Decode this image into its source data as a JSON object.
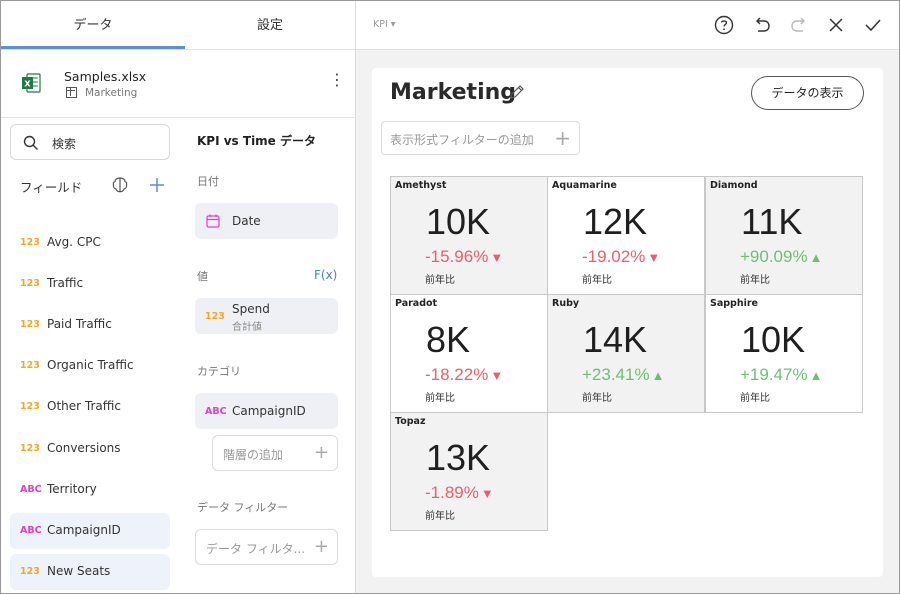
{
  "tabs": {
    "data": "データ",
    "settings": "設定"
  },
  "file": {
    "name": "Samples.xlsx",
    "sheet": "Marketing"
  },
  "search": {
    "label": "検索"
  },
  "fields": {
    "header": "フィールド",
    "items": [
      {
        "type": "123",
        "name": "Avg. CPC"
      },
      {
        "type": "123",
        "name": "Traffic"
      },
      {
        "type": "123",
        "name": "Paid Traffic"
      },
      {
        "type": "123",
        "name": "Organic Traffic"
      },
      {
        "type": "123",
        "name": "Other Traffic"
      },
      {
        "type": "123",
        "name": "Conversions"
      },
      {
        "type": "ABC",
        "name": "Territory"
      },
      {
        "type": "ABC",
        "name": "CampaignID"
      },
      {
        "type": "123",
        "name": "New Seats"
      }
    ]
  },
  "config": {
    "header": "KPI vs Time データ",
    "date_section": "日付",
    "date_field": "Date",
    "value_section": "値",
    "fx": "F(x)",
    "value_field": {
      "type": "123",
      "name": "Spend",
      "agg": "合計値"
    },
    "category_section": "カテゴリ",
    "category_field": {
      "type": "ABC",
      "name": "CampaignID"
    },
    "add_hierarchy": "階層の追加",
    "data_filter_section": "データ フィルター",
    "data_filter_placeholder": "データ フィルタ..."
  },
  "topbar": {
    "viz_type": "KPI"
  },
  "card": {
    "title": "Marketing",
    "show_data": "データの表示",
    "viz_filter": "表示形式フィルターの追加"
  },
  "kpis": [
    {
      "name": "Amethyst",
      "value": "10K",
      "change": "-15.96%",
      "dir": "down",
      "compare": "前年比"
    },
    {
      "name": "Aquamarine",
      "value": "12K",
      "change": "-19.02%",
      "dir": "down",
      "compare": "前年比"
    },
    {
      "name": "Diamond",
      "value": "11K",
      "change": "+90.09%",
      "dir": "up",
      "compare": "前年比"
    },
    {
      "name": "Paradot",
      "value": "8K",
      "change": "-18.22%",
      "dir": "down",
      "compare": "前年比"
    },
    {
      "name": "Ruby",
      "value": "14K",
      "change": "+23.41%",
      "dir": "up",
      "compare": "前年比"
    },
    {
      "name": "Sapphire",
      "value": "10K",
      "change": "+19.47%",
      "dir": "up",
      "compare": "前年比"
    },
    {
      "name": "Topaz",
      "value": "13K",
      "change": "-1.89%",
      "dir": "down",
      "compare": "前年比"
    }
  ],
  "colors": {
    "accent": "#5b8fd6",
    "negative": "#e8606b",
    "positive": "#6fbf73",
    "number_type": "#f5a623",
    "text_type": "#e040c8"
  }
}
